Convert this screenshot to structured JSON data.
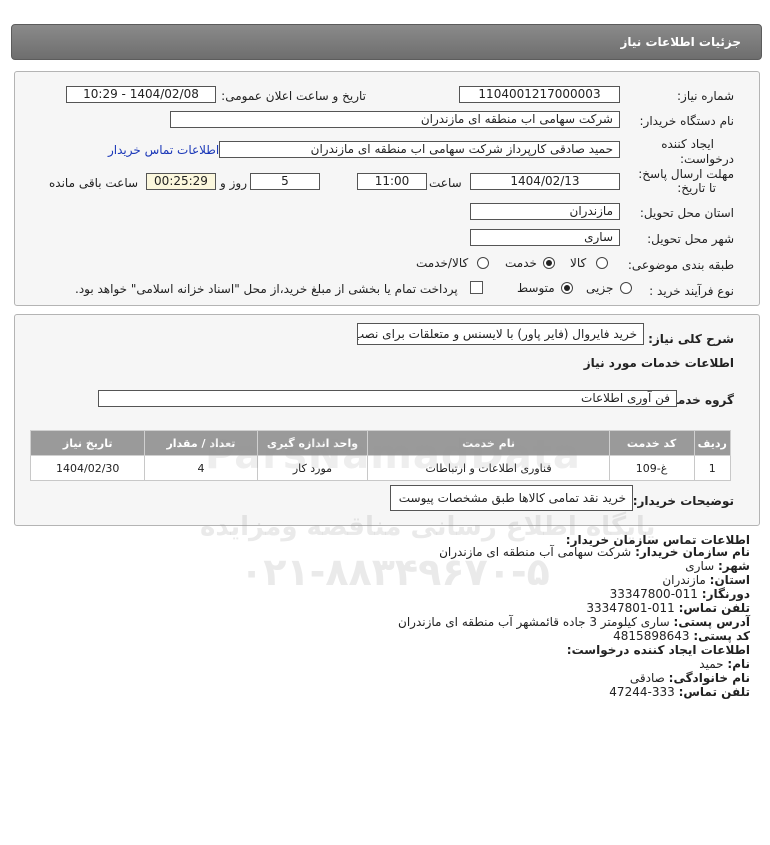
{
  "header": {
    "title": "جزئیات اطلاعات نیاز"
  },
  "form": {
    "need_number_label": "شماره نیاز:",
    "need_number": "1104001217000003",
    "announce_label": "تاریخ و ساعت اعلان عمومی:",
    "announce_value": "1404/02/08 - 10:29",
    "buyer_org_label": "نام دستگاه خریدار:",
    "buyer_org": "شرکت سهامی اب منطقه ای مازندران",
    "creator_label_1": "ایجاد کننده",
    "creator_label_2": "درخواست:",
    "creator": "حمید  صادقی کارپرداز شرکت سهامی اب منطقه ای مازندران",
    "contact_link": "اطلاعات تماس خریدار",
    "deadline_label_1": "مهلت ارسال پاسخ:",
    "deadline_label_2": "تا تاریخ:",
    "deadline_date": "1404/02/13",
    "time_label": "ساعت",
    "deadline_time": "11:00",
    "days": "5",
    "days_label": "روز و",
    "remaining": "00:25:29",
    "remaining_label": "ساعت باقی مانده",
    "province_label": "استان محل تحویل:",
    "province": "مازندران",
    "city_label": "شهر محل تحویل:",
    "city": "ساری",
    "category_label": "طبقه بندی موضوعی:",
    "category_options": [
      "کالا",
      "خدمت",
      "کالا/خدمت"
    ],
    "category_selected": "خدمت",
    "process_label": "نوع فرآیند خرید :",
    "process_options": [
      "جزیی",
      "متوسط"
    ],
    "process_selected": "متوسط",
    "payment_note": "پرداخت تمام یا بخشی از مبلغ خرید،از محل \"اسناد خزانه اسلامی\" خواهد بود."
  },
  "details": {
    "summary_label": "شرح کلی نیاز:",
    "summary": "خرید فایروال (فایر پاور) با لایسنس و متعلقات برای نصب",
    "services_heading": "اطلاعات خدمات مورد نیاز",
    "service_group_label": "گروه خدمت:",
    "service_group": "فن آوری اطلاعات",
    "table_headers": [
      "ردیف",
      "کد خدمت",
      "نام خدمت",
      "واحد اندازه گیری",
      "تعداد / مقدار",
      "تاریخ نیاز"
    ],
    "table_rows": [
      [
        "1",
        "غ-109",
        "فناوری اطلاعات و ارتباطات",
        "مورد کار",
        "4",
        "1404/02/30"
      ]
    ],
    "buyer_notes_label": "توضیحات خریدار:",
    "buyer_notes": "خرید نقد تمامی کالاها طبق مشخصات پیوست"
  },
  "contact": {
    "heading": "اطلاعات تماس سازمان خریدار:",
    "org_label": "نام سازمان خریدار:",
    "org": "شرکت سهامی آب منطقه ای مازندران",
    "city_label": "شهر:",
    "city": "ساری",
    "province_label": "استان:",
    "province": "مازندران",
    "fax_label": "دورنگار:",
    "fax": "011-33347800",
    "phone_label": "تلفن تماس:",
    "phone": "011-33347801",
    "address_label": "آدرس پستی:",
    "address": "ساری کیلومتر 3 جاده قائمشهر آب منطقه ای مازندران",
    "postal_label": "کد پستی:",
    "postal": "4815898643",
    "creator_heading": "اطلاعات ایجاد کننده درخواست:",
    "name_label": "نام:",
    "name": "حمید",
    "family_label": "نام خانوادگی:",
    "family": "صادقی",
    "creator_phone_label": "تلفن تماس:",
    "creator_phone": "333-47244"
  },
  "watermark": {
    "site": "ParsNamadData",
    "line1": "پایگاه اطلاع رسانی مناقصه ومزایده",
    "phone": "۰۲۱-۸۸۳۴۹۶۷۰-۵"
  }
}
